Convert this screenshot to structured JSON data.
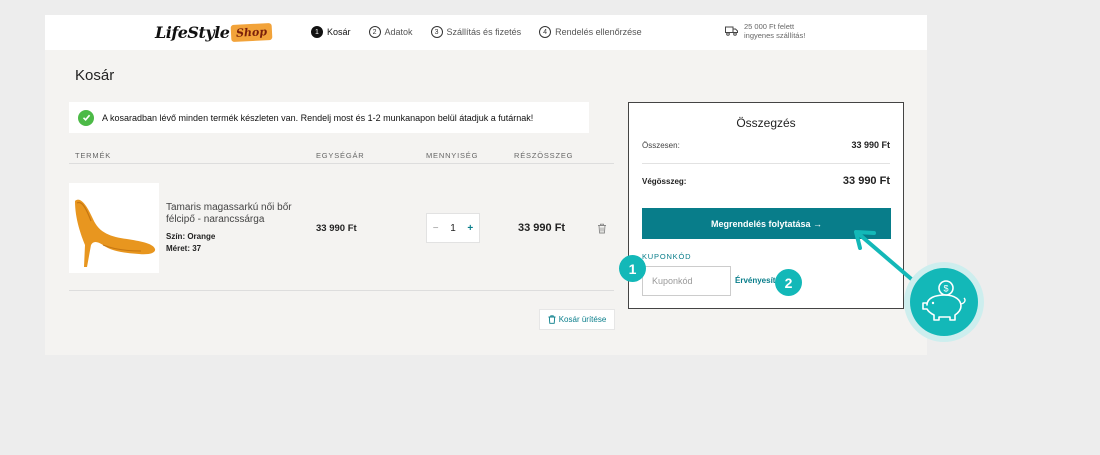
{
  "header": {
    "logo_main": "LifeStyle",
    "logo_badge": "Shop",
    "steps": [
      {
        "num": "1",
        "label": "Kosár"
      },
      {
        "num": "2",
        "label": "Adatok"
      },
      {
        "num": "3",
        "label": "Szállítás és fizetés"
      },
      {
        "num": "4",
        "label": "Rendelés ellenőrzése"
      }
    ],
    "shipping_line1": "25 000 Ft felett",
    "shipping_line2": "ingyenes szállítás!"
  },
  "page": {
    "title": "Kosár",
    "notice": "A kosaradban lévő minden termék készleten van. Rendelj most és 1-2 munkanapon belül átadjuk a futárnak!"
  },
  "table": {
    "headers": [
      "TERMÉK",
      "EGYSÉGÁR",
      "MENNYISÉG",
      "RÉSZÖSSZEG"
    ]
  },
  "product": {
    "name": "Tamaris magassarkú női bőr félcipő - narancssárga",
    "color": "Szín: Orange",
    "size": "Méret: 37",
    "unit_price": "33 990 Ft",
    "qty_minus": "−",
    "quantity": "1",
    "qty_plus": "+",
    "subtotal": "33 990 Ft"
  },
  "cart": {
    "empty_label": "Kosár ürítése"
  },
  "summary": {
    "title": "Összegzés",
    "total_label": "Összesen:",
    "total_value": "33 990 Ft",
    "grand_label": "Végösszeg:",
    "grand_value": "33 990 Ft",
    "cta_label": "Megrendelés folytatása →",
    "coupon_label": "KUPONKÓD",
    "coupon_placeholder": "Kuponkód",
    "apply_label": "Érvényesít"
  },
  "annotations": {
    "badge1": "1",
    "badge2": "2"
  },
  "icons": {
    "check": "check-icon",
    "truck": "truck-icon",
    "trash": "trash-icon",
    "piggy": "piggy-bank-icon"
  },
  "colors": {
    "accent": "#087d8a",
    "badge": "#13b8b8",
    "success": "#4cba47"
  }
}
